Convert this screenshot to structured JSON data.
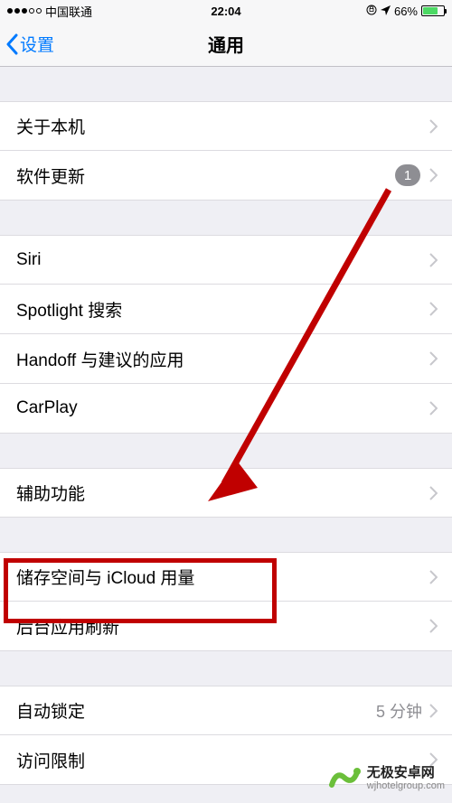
{
  "status": {
    "carrier": "中国联通",
    "time": "22:04",
    "battery_pct": "66%"
  },
  "nav": {
    "back_label": "设置",
    "title": "通用"
  },
  "sections": [
    {
      "items": [
        {
          "label": "关于本机"
        },
        {
          "label": "软件更新",
          "badge": "1"
        }
      ]
    },
    {
      "items": [
        {
          "label": "Siri"
        },
        {
          "label": "Spotlight 搜索"
        },
        {
          "label": "Handoff 与建议的应用"
        },
        {
          "label": "CarPlay"
        }
      ]
    },
    {
      "items": [
        {
          "label": "辅助功能"
        }
      ]
    },
    {
      "items": [
        {
          "label": "储存空间与 iCloud 用量"
        },
        {
          "label": "后台应用刷新"
        }
      ]
    },
    {
      "items": [
        {
          "label": "自动锁定",
          "value": "5 分钟"
        },
        {
          "label": "访问限制"
        }
      ]
    }
  ],
  "watermark": {
    "title": "无极安卓网",
    "url": "wjhotelgroup.com"
  }
}
